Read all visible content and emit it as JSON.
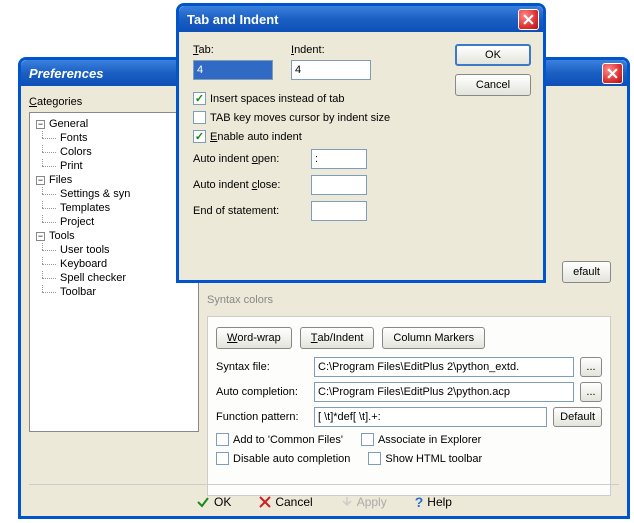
{
  "prefs": {
    "title": "Preferences",
    "categoriesLabel": "Categories",
    "tree": {
      "general": {
        "label": "General",
        "children": [
          "Fonts",
          "Colors",
          "Print"
        ]
      },
      "files": {
        "label": "Files",
        "children": [
          "Settings & syn",
          "Templates",
          "Project"
        ]
      },
      "tools": {
        "label": "Tools",
        "children": [
          "User tools",
          "Keyboard",
          "Spell checker",
          "Toolbar"
        ]
      }
    },
    "syntaxColorsTab": "Syntax colors",
    "defaultBtn": "efault",
    "panel": {
      "wordwrap": "Word-wrap",
      "tabindent": "Tab/Indent",
      "columnmarkers": "Column Markers",
      "syntaxfile": "Syntax file:",
      "syntaxfile_val": "C:\\Program Files\\EditPlus 2\\python_extd.",
      "autocompletion": "Auto completion:",
      "autocompletion_val": "C:\\Program Files\\EditPlus 2\\python.acp",
      "functionpattern": "Function pattern:",
      "functionpattern_val": "[ \\t]*def[ \\t].+:",
      "default": "Default",
      "addcommon": "Add to 'Common Files'",
      "associate": "Associate in Explorer",
      "disableauto": "Disable auto completion",
      "showhtml": "Show HTML toolbar",
      "browse": "..."
    },
    "bottom": {
      "ok": "OK",
      "cancel": "Cancel",
      "apply": "Apply",
      "help": "Help"
    }
  },
  "modal": {
    "title": "Tab and Indent",
    "tabLabel": "Tab:",
    "tabValue": "4",
    "indentLabel": "Indent:",
    "indentValue": "4",
    "ok": "OK",
    "cancel": "Cancel",
    "insertSpaces": "Insert spaces instead of tab",
    "tabKeyMoves": "TAB key moves cursor by indent size",
    "enableAutoIndent": "Enable auto indent",
    "autoIndentOpen": "Auto indent open:",
    "autoIndentOpen_val": ":",
    "autoIndentClose": "Auto indent close:",
    "autoIndentClose_val": "",
    "endOfStatement": "End of statement:",
    "endOfStatement_val": ""
  }
}
